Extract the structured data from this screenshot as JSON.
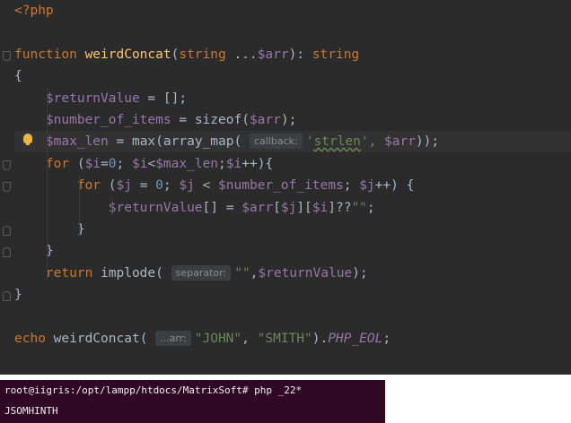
{
  "editor": {
    "lines": [
      {
        "tokens": [
          {
            "t": "<?php",
            "c": "kw"
          }
        ]
      },
      {
        "tokens": []
      },
      {
        "tokens": [
          {
            "t": "function ",
            "c": "kw"
          },
          {
            "t": "weirdConcat",
            "c": "fn"
          },
          {
            "t": "(",
            "c": ""
          },
          {
            "t": "string ",
            "c": "kw"
          },
          {
            "t": "...",
            "c": ""
          },
          {
            "t": "$arr",
            "c": "var"
          },
          {
            "t": "): ",
            "c": ""
          },
          {
            "t": "string",
            "c": "kw"
          }
        ]
      },
      {
        "tokens": [
          {
            "t": "{",
            "c": ""
          }
        ]
      },
      {
        "tokens": [
          {
            "t": "    ",
            "c": ""
          },
          {
            "t": "$returnValue",
            "c": "var"
          },
          {
            "t": " = [];",
            "c": ""
          }
        ]
      },
      {
        "tokens": [
          {
            "t": "    ",
            "c": ""
          },
          {
            "t": "$number_of_items",
            "c": "var"
          },
          {
            "t": " = ",
            "c": ""
          },
          {
            "t": "sizeof",
            "c": ""
          },
          {
            "t": "(",
            "c": ""
          },
          {
            "t": "$arr",
            "c": "var"
          },
          {
            "t": ");",
            "c": ""
          }
        ]
      },
      {
        "current": true,
        "tokens": [
          {
            "t": "    ",
            "c": ""
          },
          {
            "t": "$max_len",
            "c": "var"
          },
          {
            "t": " = ",
            "c": ""
          },
          {
            "t": "max",
            "c": ""
          },
          {
            "t": "(",
            "c": ""
          },
          {
            "t": "array_map",
            "c": ""
          },
          {
            "t": "( ",
            "c": ""
          },
          {
            "t": "callback:",
            "c": "hint"
          },
          {
            "t": "'",
            "c": "str"
          },
          {
            "t": "strlen",
            "c": "str squig"
          },
          {
            "t": "', ",
            "c": "str"
          },
          {
            "t": "$arr",
            "c": "var"
          },
          {
            "t": "));",
            "c": ""
          }
        ]
      },
      {
        "tokens": [
          {
            "t": "    ",
            "c": ""
          },
          {
            "t": "for ",
            "c": "kw"
          },
          {
            "t": "(",
            "c": ""
          },
          {
            "t": "$i",
            "c": "var"
          },
          {
            "t": "=",
            "c": ""
          },
          {
            "t": "0",
            "c": "num"
          },
          {
            "t": "; ",
            "c": ""
          },
          {
            "t": "$i",
            "c": "var"
          },
          {
            "t": "<",
            "c": ""
          },
          {
            "t": "$max_len",
            "c": "var"
          },
          {
            "t": ";",
            "c": ""
          },
          {
            "t": "$i",
            "c": "var"
          },
          {
            "t": "++){",
            "c": ""
          }
        ]
      },
      {
        "tokens": [
          {
            "t": "        ",
            "c": ""
          },
          {
            "t": "for ",
            "c": "kw"
          },
          {
            "t": "(",
            "c": ""
          },
          {
            "t": "$j",
            "c": "var"
          },
          {
            "t": " = ",
            "c": ""
          },
          {
            "t": "0",
            "c": "num"
          },
          {
            "t": "; ",
            "c": ""
          },
          {
            "t": "$j",
            "c": "var"
          },
          {
            "t": " < ",
            "c": ""
          },
          {
            "t": "$number_of_items",
            "c": "var"
          },
          {
            "t": "; ",
            "c": ""
          },
          {
            "t": "$j",
            "c": "var"
          },
          {
            "t": "++) {",
            "c": ""
          }
        ]
      },
      {
        "tokens": [
          {
            "t": "            ",
            "c": ""
          },
          {
            "t": "$returnValue",
            "c": "var"
          },
          {
            "t": "[] = ",
            "c": ""
          },
          {
            "t": "$arr",
            "c": "var"
          },
          {
            "t": "[",
            "c": ""
          },
          {
            "t": "$j",
            "c": "var"
          },
          {
            "t": "][",
            "c": ""
          },
          {
            "t": "$i",
            "c": "var"
          },
          {
            "t": "]??",
            "c": ""
          },
          {
            "t": "\"\"",
            "c": "str"
          },
          {
            "t": ";",
            "c": ""
          }
        ]
      },
      {
        "tokens": [
          {
            "t": "        }",
            "c": ""
          }
        ]
      },
      {
        "tokens": [
          {
            "t": "    }",
            "c": ""
          }
        ]
      },
      {
        "tokens": [
          {
            "t": "    ",
            "c": ""
          },
          {
            "t": "return ",
            "c": "kw"
          },
          {
            "t": "implode",
            "c": ""
          },
          {
            "t": "( ",
            "c": ""
          },
          {
            "t": "separator:",
            "c": "hint"
          },
          {
            "t": "\"\"",
            "c": "str"
          },
          {
            "t": ",",
            "c": ""
          },
          {
            "t": "$returnValue",
            "c": "var"
          },
          {
            "t": ");",
            "c": ""
          }
        ]
      },
      {
        "tokens": [
          {
            "t": "}",
            "c": ""
          }
        ]
      },
      {
        "tokens": []
      },
      {
        "tokens": [
          {
            "t": "echo ",
            "c": "kw"
          },
          {
            "t": "weirdConcat",
            "c": ""
          },
          {
            "t": "( ",
            "c": ""
          },
          {
            "t": "...arr:",
            "c": "hint"
          },
          {
            "t": "\"JOHN\"",
            "c": "str"
          },
          {
            "t": ", ",
            "c": ""
          },
          {
            "t": "\"SMITH\"",
            "c": "str"
          },
          {
            "t": ").",
            "c": ""
          },
          {
            "t": "PHP_EOL",
            "c": "const"
          },
          {
            "t": ";",
            "c": ""
          }
        ]
      }
    ]
  },
  "terminal": {
    "prompt_line": "root@iigris:/opt/lampp/htdocs/MatrixSoft# php _22*",
    "output_line": "JSOMHINTH"
  },
  "colors": {
    "editor_bg": "#2b2b2b",
    "keyword": "#cc7832",
    "variable": "#9876aa",
    "function": "#ffc66d",
    "string": "#6a8759",
    "number": "#6897bb",
    "terminal_bg": "#300a24"
  }
}
